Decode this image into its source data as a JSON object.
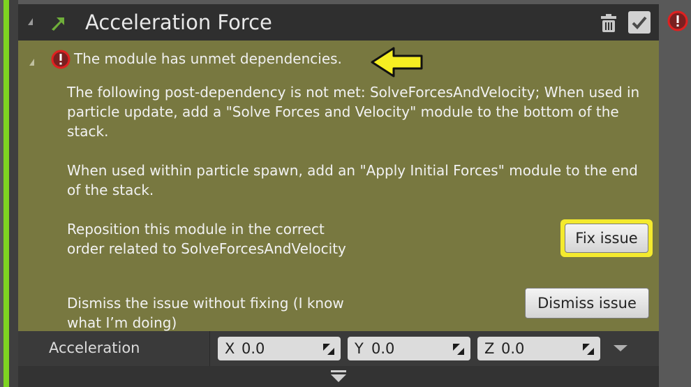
{
  "module": {
    "title": "Acceleration Force"
  },
  "issue": {
    "headline": "The module has unmet dependencies.",
    "description_1": "The following post-dependency is not met: SolveForcesAndVelocity; When used in particle update, add a \"Solve Forces and Velocity\" module to the bottom of the stack.",
    "description_2": "When used within particle spawn, add an \"Apply Initial Forces\" module to the end of the stack.",
    "fix_description": "Reposition this module in the correct order related to SolveForcesAndVelocity",
    "fix_label": "Fix issue",
    "dismiss_description": "Dismiss the issue without fixing (I know what I’m doing)",
    "dismiss_label": "Dismiss issue"
  },
  "parameter": {
    "label": "Acceleration",
    "x_axis": "X",
    "x_value": "0.0",
    "y_axis": "Y",
    "y_value": "0.0",
    "z_axis": "Z",
    "z_value": "0.0"
  },
  "icons": {
    "module": "green-arrow-icon",
    "delete": "trash-icon",
    "enable": "checkbox-checked-icon",
    "error": "error-icon",
    "callout": "yellow-arrow-icon",
    "dropdown": "dropdown-icon",
    "expand": "expand-down-icon"
  },
  "colors": {
    "accent": "#7ed321",
    "issue_background": "#787840",
    "highlight": "#f4ea2e",
    "error": "#c00000"
  }
}
